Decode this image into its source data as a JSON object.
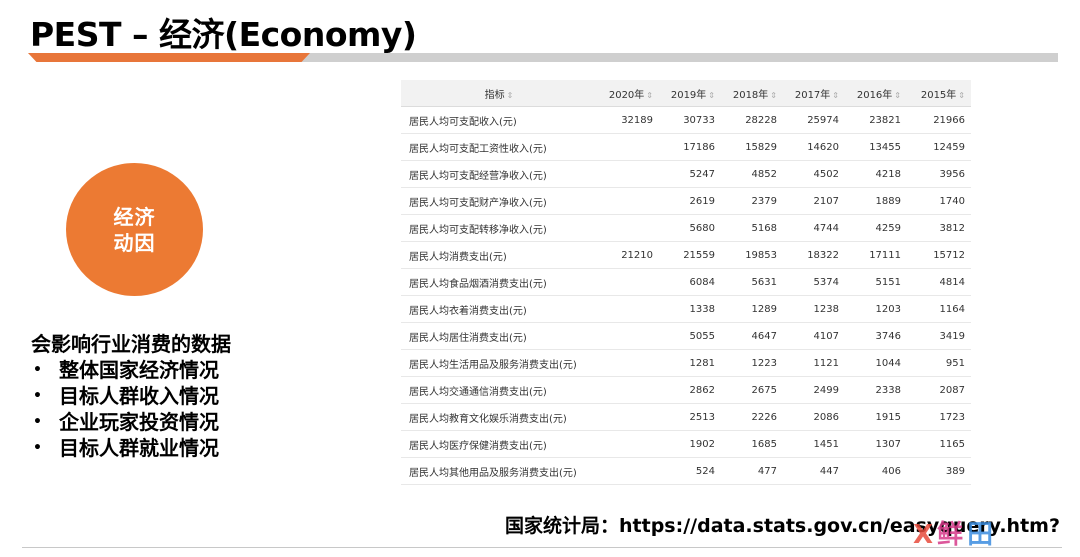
{
  "title": "PEST – 经济(Economy)",
  "circle": {
    "line1": "经济",
    "line2": "动因"
  },
  "points": {
    "heading": "会影响行业消费的数据",
    "bullet_char": "•",
    "items": [
      "整体国家经济情况",
      "目标人群收入情况",
      "企业玩家投资情况",
      "目标人群就业情况"
    ]
  },
  "table": {
    "sort_glyph": "⇕",
    "headers": [
      "指标",
      "2020年",
      "2019年",
      "2018年",
      "2017年",
      "2016年",
      "2015年"
    ],
    "rows": [
      [
        "居民人均可支配收入(元)",
        "32189",
        "30733",
        "28228",
        "25974",
        "23821",
        "21966"
      ],
      [
        "居民人均可支配工资性收入(元)",
        "",
        "17186",
        "15829",
        "14620",
        "13455",
        "12459"
      ],
      [
        "居民人均可支配经营净收入(元)",
        "",
        "5247",
        "4852",
        "4502",
        "4218",
        "3956"
      ],
      [
        "居民人均可支配财产净收入(元)",
        "",
        "2619",
        "2379",
        "2107",
        "1889",
        "1740"
      ],
      [
        "居民人均可支配转移净收入(元)",
        "",
        "5680",
        "5168",
        "4744",
        "4259",
        "3812"
      ],
      [
        "居民人均消费支出(元)",
        "21210",
        "21559",
        "19853",
        "18322",
        "17111",
        "15712"
      ],
      [
        "居民人均食品烟酒消费支出(元)",
        "",
        "6084",
        "5631",
        "5374",
        "5151",
        "4814"
      ],
      [
        "居民人均衣着消费支出(元)",
        "",
        "1338",
        "1289",
        "1238",
        "1203",
        "1164"
      ],
      [
        "居民人均居住消费支出(元)",
        "",
        "5055",
        "4647",
        "4107",
        "3746",
        "3419"
      ],
      [
        "居民人均生活用品及服务消费支出(元)",
        "",
        "1281",
        "1223",
        "1121",
        "1044",
        "951"
      ],
      [
        "居民人均交通通信消费支出(元)",
        "",
        "2862",
        "2675",
        "2499",
        "2338",
        "2087"
      ],
      [
        "居民人均教育文化娱乐消费支出(元)",
        "",
        "2513",
        "2226",
        "2086",
        "1915",
        "1723"
      ],
      [
        "居民人均医疗保健消费支出(元)",
        "",
        "1902",
        "1685",
        "1451",
        "1307",
        "1165"
      ],
      [
        "居民人均其他用品及服务消费支出(元)",
        "",
        "524",
        "477",
        "447",
        "406",
        "389"
      ]
    ]
  },
  "source": {
    "label": "国家统计局：",
    "url": "https://data.stats.gov.cn/easyquery.htm?"
  },
  "watermark": {
    "mark": "X",
    "text1": "鲜",
    "text2": "田"
  },
  "colors": {
    "accent": "#ec7a33",
    "bar_gray": "#cfcfcf"
  }
}
